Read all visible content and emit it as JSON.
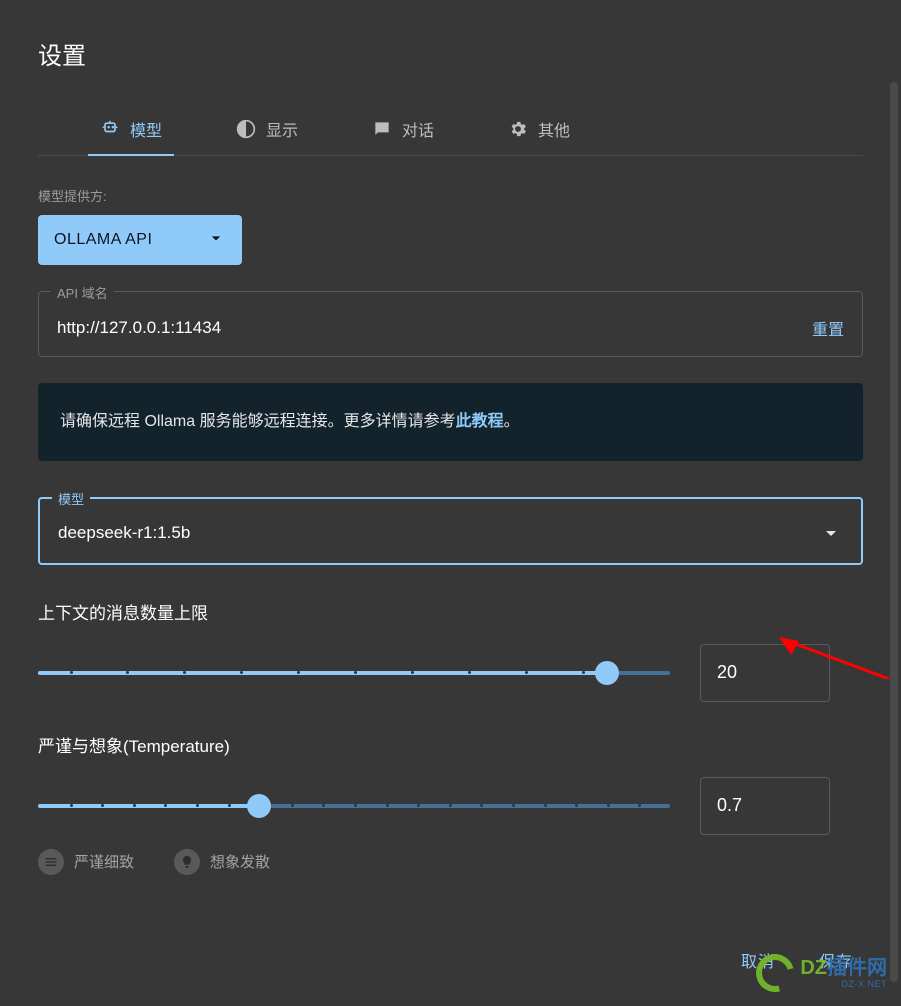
{
  "dialog": {
    "title": "设置"
  },
  "tabs": [
    {
      "id": "model",
      "label": "模型",
      "icon": "robot-icon",
      "active": true
    },
    {
      "id": "display",
      "label": "显示",
      "icon": "contrast-icon",
      "active": false
    },
    {
      "id": "chat",
      "label": "对话",
      "icon": "chat-icon",
      "active": false
    },
    {
      "id": "other",
      "label": "其他",
      "icon": "gear-icon",
      "active": false
    }
  ],
  "provider": {
    "label": "模型提供方:",
    "selected": "OLLAMA API"
  },
  "api_domain": {
    "label": "API 域名",
    "value": "http://127.0.0.1:11434",
    "reset_label": "重置"
  },
  "banner": {
    "prefix": "请确保远程 Ollama 服务能够远程连接。更多详情请参考",
    "link": "此教程",
    "suffix": "。"
  },
  "model_select": {
    "label": "模型",
    "value": "deepseek-r1:1.5b"
  },
  "context_limit": {
    "title": "上下文的消息数量上限",
    "value": "20",
    "min": 0,
    "max": 22,
    "percent": 90
  },
  "temperature": {
    "title": "严谨与想象(Temperature)",
    "value": "0.7",
    "min": 0,
    "max": 2,
    "percent": 35,
    "chip_strict": "严谨细致",
    "chip_creative": "想象发散"
  },
  "footer": {
    "cancel": "取消",
    "save": "保存"
  },
  "watermark": {
    "brand_dz": "DZ",
    "brand_rest": "插件网",
    "sub": "DZ-X.NET"
  }
}
